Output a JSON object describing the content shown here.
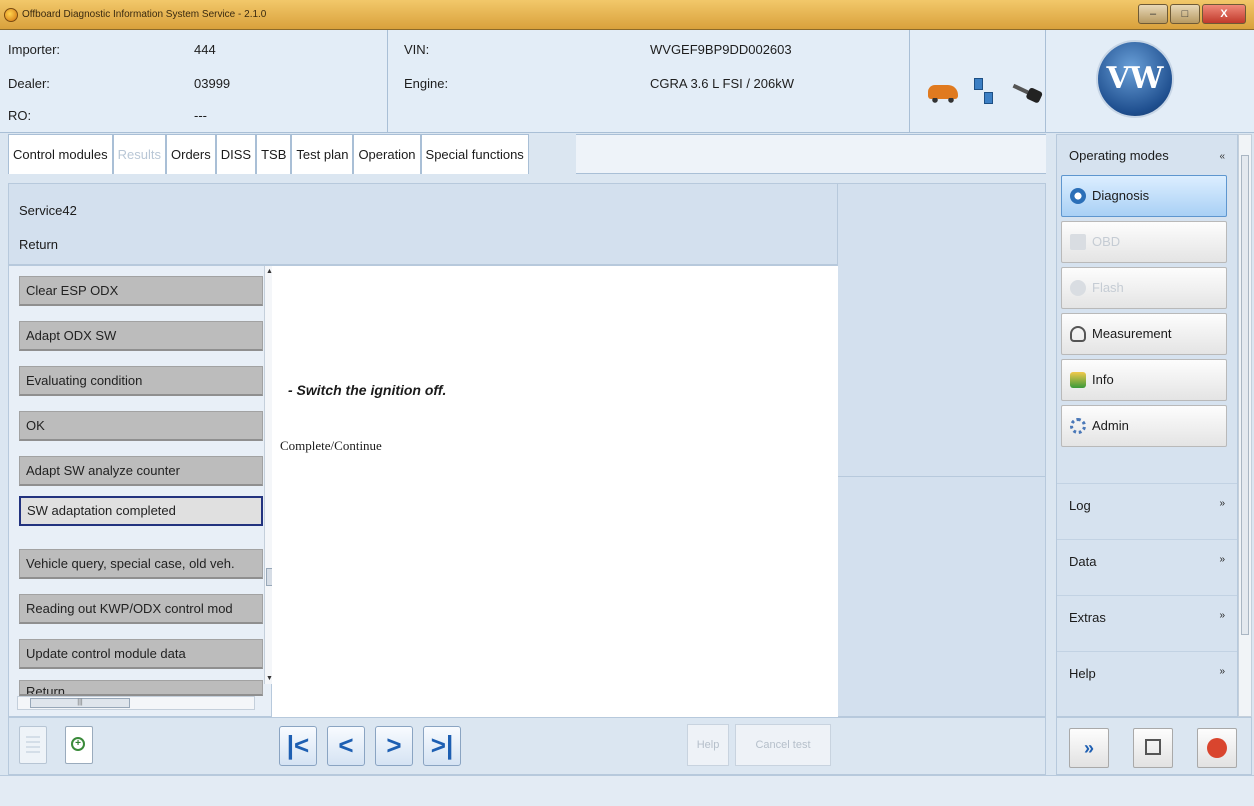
{
  "window": {
    "title": "Offboard Diagnostic Information System Service - 2.1.0",
    "minimize": "–",
    "maximize": "□",
    "close": "X"
  },
  "header": {
    "importer_label": "Importer:",
    "importer_value": "444",
    "dealer_label": "Dealer:",
    "dealer_value": "03999",
    "ro_label": "RO:",
    "ro_value": "---",
    "vin_label": "VIN:",
    "vin_value": "WVGEF9BP9DD002603",
    "engine_label": "Engine:",
    "engine_value": "CGRA 3.6 L FSI / 206kW",
    "logo_text": "VW"
  },
  "tabs": [
    {
      "label": "Control modules",
      "state": "normal"
    },
    {
      "label": "Results",
      "state": "disabled"
    },
    {
      "label": "Orders",
      "state": "normal"
    },
    {
      "label": "DISS",
      "state": "normal"
    },
    {
      "label": "TSB",
      "state": "normal"
    },
    {
      "label": "Test plan",
      "state": "normal"
    },
    {
      "label": "Operation",
      "state": "active"
    },
    {
      "label": "Special functions",
      "state": "normal"
    }
  ],
  "service": {
    "name": "Service42",
    "return_label": "Return"
  },
  "steps": [
    "Clear ESP ODX",
    "Adapt ODX SW",
    "Evaluating condition",
    "OK",
    "Adapt SW analyze counter",
    "SW adaptation completed",
    "Vehicle query, special case, old veh.",
    "Reading out KWP/ODX control mod",
    "Update control module data",
    "Return"
  ],
  "selected_step": "SW adaptation completed",
  "content": {
    "instruction": "- Switch the ignition off.",
    "continue_text": "Complete/Continue"
  },
  "bottom_toolbar": {
    "first": "|<",
    "prev": "<",
    "next": ">",
    "last": ">|",
    "help": "Help",
    "cancel_test": "Cancel test"
  },
  "sidebar": {
    "title": "Operating modes",
    "modes": [
      {
        "label": "Diagnosis",
        "state": "active",
        "icon": "diagnosis-icon"
      },
      {
        "label": "OBD",
        "state": "disabled",
        "icon": "obd-icon"
      },
      {
        "label": "Flash",
        "state": "disabled",
        "icon": "flash-icon"
      },
      {
        "label": "Measurement",
        "state": "normal",
        "icon": "gauge-icon"
      },
      {
        "label": "Info",
        "state": "normal",
        "icon": "info-icon"
      },
      {
        "label": "Admin",
        "state": "normal",
        "icon": "admin-icon"
      }
    ],
    "sections": [
      "Log",
      "Data",
      "Extras",
      "Help"
    ],
    "collapse_glyph": "»",
    "expand_glyph": "«"
  },
  "colors": {
    "accent_blue": "#1e5fb2",
    "selected_border": "#23337f",
    "active_mode": "#a9d0f5"
  }
}
